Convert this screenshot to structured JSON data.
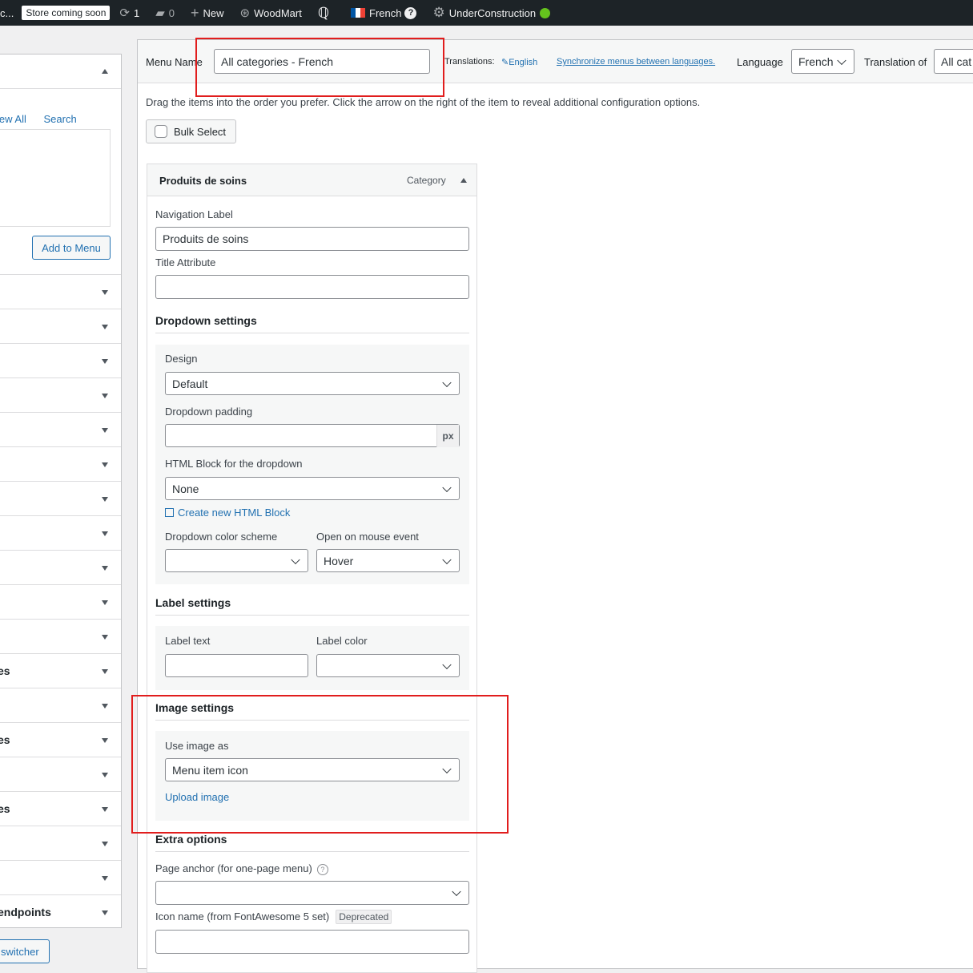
{
  "admin_bar": {
    "site_name": "c...",
    "store_badge": "Store coming soon",
    "updates_count": "1",
    "comments_count": "0",
    "new_label": "New",
    "theme_label": "WoodMart",
    "language_label": "French",
    "language_help": "?",
    "maintenance_label": "UnderConstruction"
  },
  "left_panel": {
    "tab_view_all": "iew All",
    "tab_search": "Search",
    "add_to_menu": "Add to Menu",
    "rows": [
      "",
      "",
      "",
      "",
      "",
      "",
      "",
      "",
      "",
      "",
      "",
      "es",
      "",
      "es",
      "",
      "es",
      "",
      "",
      "endpoints"
    ],
    "switcher_button": "switcher"
  },
  "menu_header": {
    "menu_name_label": "Menu Name",
    "menu_name_value": "All categories - French",
    "translations_label": "Translations:",
    "translation_english": "English",
    "sync_link": "Synchronize menus between languages.",
    "language_label": "Language",
    "language_value": "French",
    "translation_of_label": "Translation of",
    "translation_of_value": "All cat"
  },
  "instructions": "Drag the items into the order you prefer. Click the arrow on the right of the item to reveal additional configuration options.",
  "bulk_select": "Bulk Select",
  "menu_item": {
    "title": "Produits de soins",
    "type": "Category",
    "navigation_label": "Navigation Label",
    "navigation_value": "Produits de soins",
    "title_attribute": "Title Attribute",
    "title_attribute_value": "",
    "dropdown_settings": "Dropdown settings",
    "design_label": "Design",
    "design_value": "Default",
    "dropdown_padding_label": "Dropdown padding",
    "dropdown_padding_unit": "px",
    "html_block_label": "HTML Block for the dropdown",
    "html_block_value": "None",
    "create_html_block": "Create new HTML Block",
    "color_scheme_label": "Dropdown color scheme",
    "color_scheme_value": "",
    "mouse_event_label": "Open on mouse event",
    "mouse_event_value": "Hover",
    "label_settings": "Label settings",
    "label_text_label": "Label text",
    "label_color_label": "Label color",
    "image_settings": "Image settings",
    "use_image_label": "Use image as",
    "use_image_value": "Menu item icon",
    "upload_image": "Upload image",
    "extra_options": "Extra options",
    "page_anchor_label": "Page anchor (for one-page menu)",
    "icon_name_label": "Icon name (from FontAwesome 5 set)",
    "deprecated_badge": "Deprecated"
  },
  "colors": {
    "admin_bar_bg": "#1d2327",
    "link": "#2271b1",
    "highlight": "#e11d1d",
    "status_green": "#65c31d"
  }
}
